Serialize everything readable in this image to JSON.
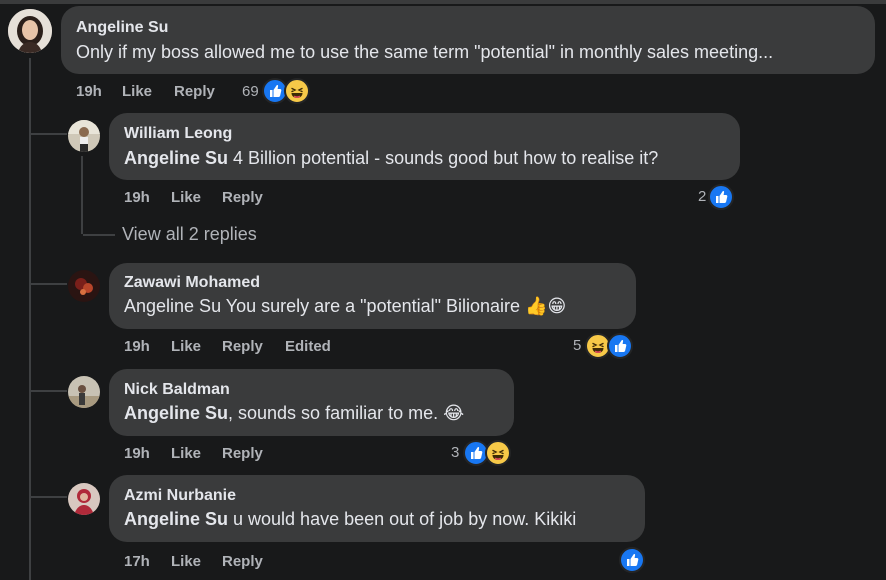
{
  "comment": {
    "author": "Angeline Su",
    "text": "Only if my boss allowed me to use the same term \"potential\" in monthly sales meeting...",
    "time": "19h",
    "like_label": "Like",
    "reply_label": "Reply",
    "reaction_count": "69"
  },
  "view_all_replies": "View all 2 replies",
  "replies": [
    {
      "author": "William Leong",
      "tag": "Angeline Su",
      "text": " 4 Billion potential - sounds good but how to realise it?",
      "time": "19h",
      "like_label": "Like",
      "reply_label": "Reply",
      "edited": "",
      "reaction_count": "2"
    },
    {
      "author": "Zawawi Mohamed",
      "tag": "",
      "text": "Angeline Su You surely are a \"potential\" Bilionaire 👍😁",
      "time": "19h",
      "like_label": "Like",
      "reply_label": "Reply",
      "edited": "Edited",
      "reaction_count": "5"
    },
    {
      "author": "Nick Baldman",
      "tag": "Angeline Su",
      "text": ", sounds so familiar to me. 😂",
      "time": "19h",
      "like_label": "Like",
      "reply_label": "Reply",
      "edited": "",
      "reaction_count": "3"
    },
    {
      "author": "Azmi Nurbanie",
      "tag": "Angeline Su",
      "text": " u would have been out of job by now. Kikiki",
      "time": "17h",
      "like_label": "Like",
      "reply_label": "Reply",
      "edited": "",
      "reaction_count": ""
    }
  ],
  "icons": {
    "like": "like-reaction-icon",
    "haha": "haha-reaction-icon"
  },
  "colors": {
    "background": "#18191a",
    "bubble": "#3a3b3c",
    "like_blue": "#1877f2",
    "haha_yellow": "#f7c948"
  }
}
